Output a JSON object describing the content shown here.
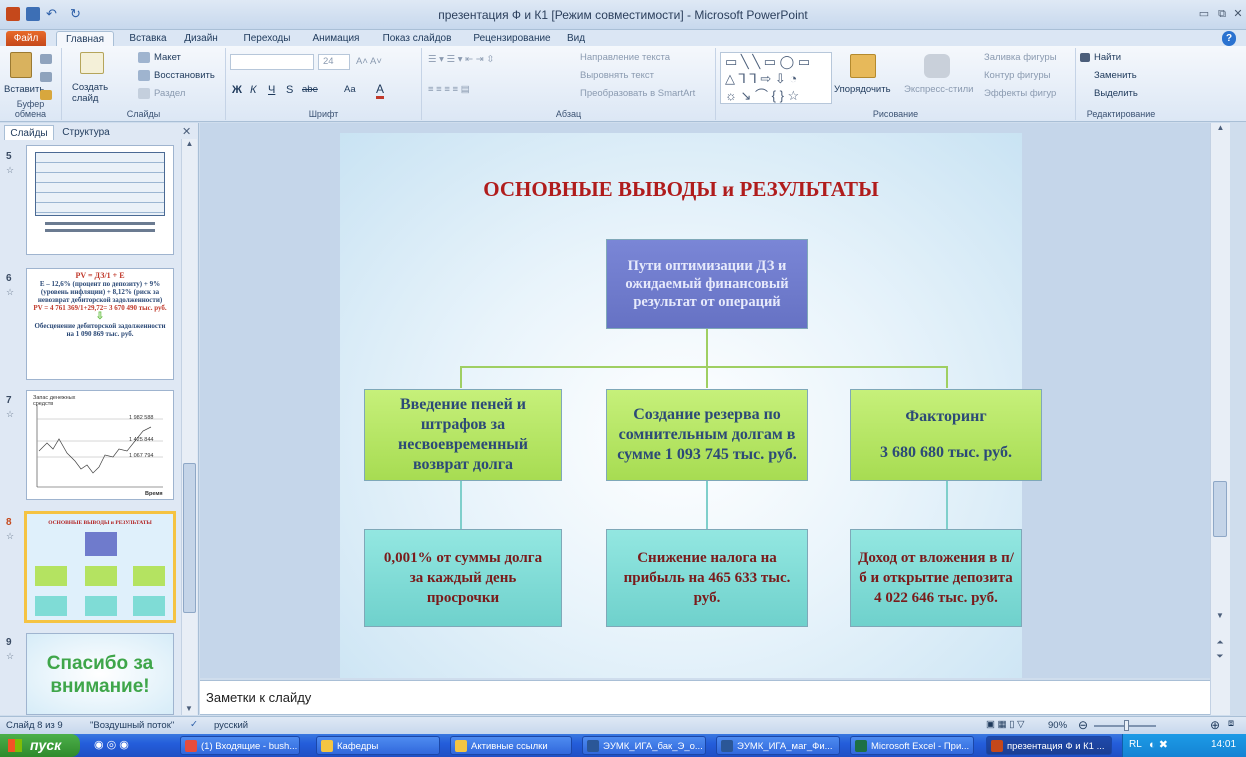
{
  "window": {
    "title": "презентация Ф и К1 [Режим совместимости] - Microsoft PowerPoint"
  },
  "tabs": [
    "Файл",
    "Главная",
    "Вставка",
    "Дизайн",
    "Переходы",
    "Анимация",
    "Показ слайдов",
    "Рецензирование",
    "Вид"
  ],
  "ribbon": {
    "clipboard": {
      "paste": "Вставить",
      "label": "Буфер обмена"
    },
    "slides": {
      "create": "Создать слайд",
      "layout": "Макет",
      "reset": "Восстановить",
      "section": "Раздел",
      "label": "Слайды"
    },
    "font": {
      "size": "24",
      "label": "Шрифт",
      "bold": "Ж",
      "italic": "К",
      "underline": "Ч",
      "strike": "S",
      "abc": "abe",
      "aa": "Aa",
      "a": "A"
    },
    "paragraph": {
      "direction": "Направление текста",
      "align": "Выровнять текст",
      "smartart": "Преобразовать в SmartArt",
      "label": "Абзац"
    },
    "drawing": {
      "arrange": "Упорядочить",
      "styles": "Экспресс-стили",
      "fill": "Заливка фигуры",
      "outline": "Контур фигуры",
      "effects": "Эффекты фигур",
      "label": "Рисование"
    },
    "editing": {
      "find": "Найти",
      "replace": "Заменить",
      "select": "Выделить",
      "label": "Редактирование"
    }
  },
  "panel": {
    "tab_slides": "Слайды",
    "tab_outline": "Структура"
  },
  "thumbs": {
    "n5": "5",
    "n6": "6",
    "n7": "7",
    "n8": "8",
    "n9": "9",
    "t6_l1": "PV = ДЗ/1 + E",
    "t6_l2": "E – 12,6% (процент по депозиту) + 9% (уровень инфляции) + 8,12% (риск за невозврат дебиторской задолженности)",
    "t6_l3": "PV = 4 761 369/1+29,72= 3 670 490 тыс. руб.",
    "t6_l4": "Обесценение дебиторской задолженности на 1 090 869 тыс. руб.",
    "t7_title": "Запас денежных средств",
    "t7_v1": "1 982 588",
    "t7_v2": "1 425 844",
    "t7_v3": "1 067 794",
    "t7_x": "Время",
    "t8_title": "ОСНОВНЫЕ ВЫВОДЫ и РЕЗУЛЬТАТЫ",
    "t9_text": "Спасибо за внимание!"
  },
  "slide": {
    "title": "ОСНОВНЫЕ ВЫВОДЫ и РЕЗУЛЬТАТЫ",
    "center": "Пути оптимизации ДЗ и ожидаемый финансовый результат от операций",
    "b1": "Введение пеней и штрафов за несвоевременный возврат долга",
    "b2": "Создание резерва по сомнительным долгам в сумме 1 093 745 тыс. руб.",
    "b3a": "Факторинг",
    "b3b": "3 680 680 тыс. руб.",
    "r1": "0,001% от суммы долга за каждый день просрочки",
    "r2": "Снижение налога на прибыль на 465 633 тыс. руб.",
    "r3": "Доход от вложения в п/б и открытие депозита 4 022 646 тыс. руб."
  },
  "notes": {
    "placeholder": "Заметки к слайду"
  },
  "status": {
    "slide": "Слайд 8 из 9",
    "theme": "\"Воздушный поток\"",
    "lang": "русский",
    "zoom": "90%"
  },
  "taskbar": {
    "start": "пуск",
    "items": [
      "(1) Входящие - bush...",
      "Кафедры",
      "Активные ссылки",
      "ЭУМК_ИГА_бак_Э_о...",
      "ЭУМК_ИГА_маг_Фи...",
      "Microsoft Excel - При...",
      "презентация Ф и К1 ..."
    ],
    "lang": "RL",
    "time": "14:01"
  },
  "colors": {
    "title_red": "#b01c1c",
    "green_box": "#b4e361",
    "teal_box": "#7fdcd6",
    "blue_box": "#6f7bcc"
  }
}
